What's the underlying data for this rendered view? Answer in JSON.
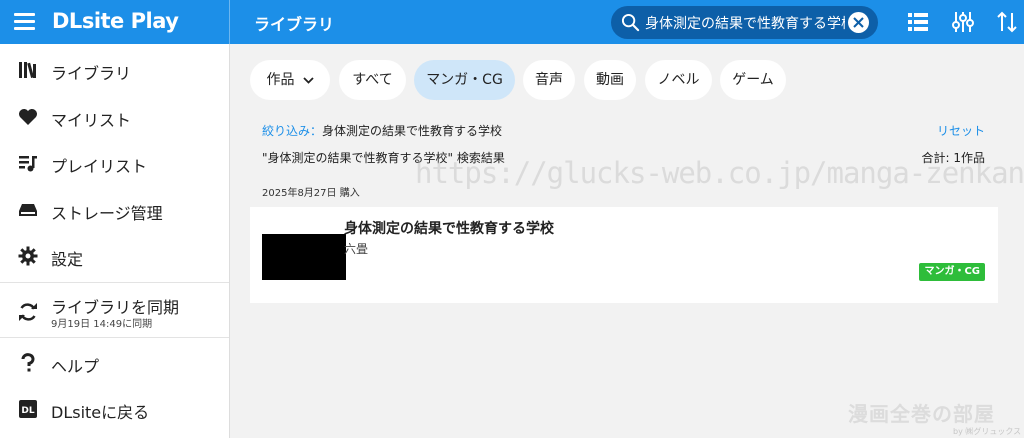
{
  "app": {
    "brand": "DLsite Play",
    "page_title": "ライブラリ"
  },
  "search": {
    "value": "身体測定の結果で性教育する学校"
  },
  "sidebar": {
    "items": [
      {
        "label": "ライブラリ",
        "icon": "library-icon"
      },
      {
        "label": "マイリスト",
        "icon": "heart-icon"
      },
      {
        "label": "プレイリスト",
        "icon": "playlist-icon"
      },
      {
        "label": "ストレージ管理",
        "icon": "storage-icon"
      },
      {
        "label": "設定",
        "icon": "gear-icon"
      }
    ],
    "sync": {
      "label": "ライブラリを同期",
      "last_sync": "9月19日 14:49に同期"
    },
    "bottom": [
      {
        "label": "ヘルプ",
        "icon": "help-icon"
      },
      {
        "label": "DLsiteに戻る",
        "icon": "dlsite-icon"
      }
    ]
  },
  "filters": {
    "dropdown": "作品",
    "chips": [
      "すべて",
      "マンガ・CG",
      "音声",
      "動画",
      "ノベル",
      "ゲーム"
    ],
    "active": "マンガ・CG"
  },
  "refine": {
    "key": "絞り込み：",
    "value": "身体測定の結果で性教育する学校",
    "reset": "リセット",
    "result_query": "\"身体測定の結果で性教育する学校\" 検索結果",
    "total": "合計: 1作品"
  },
  "purchase_date": "2025年8月27日 購入",
  "works": [
    {
      "title": "身体測定の結果で性教育する学校",
      "circle": "六畳",
      "badge": "マンガ・CG"
    }
  ],
  "overlays": {
    "watermark": "https://glucks-web.co.jp/manga-zenkan/",
    "corner_logo": "漫画全巻の部屋",
    "corner_sub": "by ㈱グリュックス"
  },
  "colors": {
    "primary": "#1c8fe8",
    "badge_green": "#2ebd3a",
    "chip_active": "#cfe6f9"
  }
}
